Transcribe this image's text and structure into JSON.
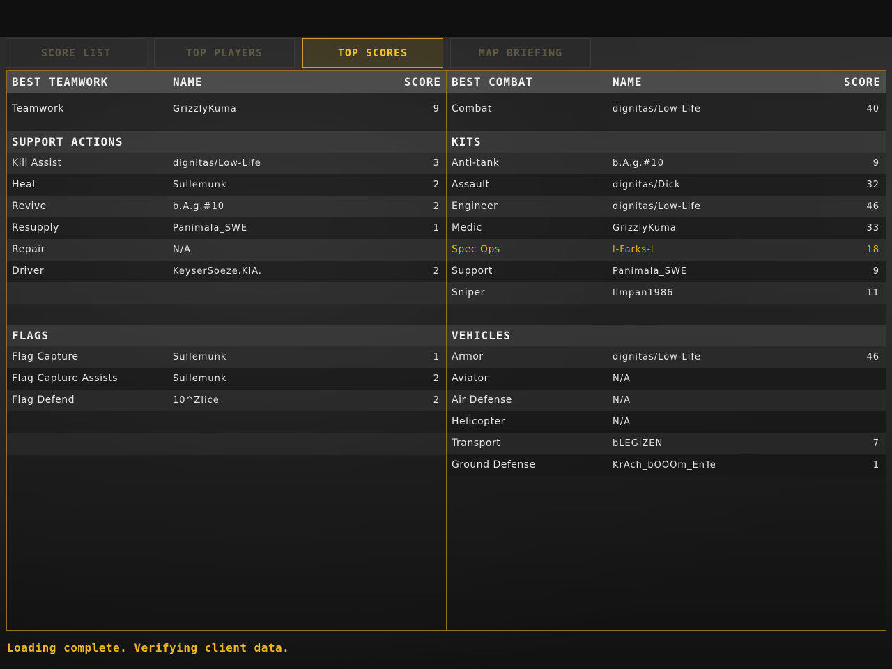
{
  "tabs": [
    {
      "label": "SCORE LIST",
      "active": false
    },
    {
      "label": "TOP PLAYERS",
      "active": false
    },
    {
      "label": "TOP SCORES",
      "active": true
    },
    {
      "label": "MAP BRIEFING",
      "active": false
    }
  ],
  "left": {
    "header": {
      "category": "BEST TEAMWORK",
      "name": "NAME",
      "score": "SCORE"
    },
    "teamwork": [
      {
        "category": "Teamwork",
        "name": "GrizzlyKuma",
        "score": "9"
      }
    ],
    "support_title": "SUPPORT ACTIONS",
    "support": [
      {
        "category": "Kill Assist",
        "name": "dignitas/Low-Life",
        "score": "3"
      },
      {
        "category": "Heal",
        "name": "Sullemunk",
        "score": "2"
      },
      {
        "category": "Revive",
        "name": "b.A.g.#10",
        "score": "2"
      },
      {
        "category": "Resupply",
        "name": "Panimala_SWE",
        "score": "1"
      },
      {
        "category": "Repair",
        "name": "N/A",
        "score": ""
      },
      {
        "category": "Driver",
        "name": "KeyserSoeze.KIA.",
        "score": "2"
      }
    ],
    "flags_title": "FLAGS",
    "flags": [
      {
        "category": "Flag Capture",
        "name": "Sullemunk",
        "score": "1"
      },
      {
        "category": "Flag Capture Assists",
        "name": "Sullemunk",
        "score": "2"
      },
      {
        "category": "Flag Defend",
        "name": "10^Zlice",
        "score": "2"
      }
    ]
  },
  "right": {
    "header": {
      "category": "BEST COMBAT",
      "name": "NAME",
      "score": "SCORE"
    },
    "combat": [
      {
        "category": "Combat",
        "name": "dignitas/Low-Life",
        "score": "40"
      }
    ],
    "kits_title": "KITS",
    "kits": [
      {
        "category": "Anti-tank",
        "name": "b.A.g.#10",
        "score": "9"
      },
      {
        "category": "Assault",
        "name": "dignitas/Dick",
        "score": "32"
      },
      {
        "category": "Engineer",
        "name": "dignitas/Low-Life",
        "score": "46"
      },
      {
        "category": "Medic",
        "name": "GrizzlyKuma",
        "score": "33"
      },
      {
        "category": "Spec Ops",
        "name": "l-Farks-l",
        "score": "18",
        "highlight": true
      },
      {
        "category": "Support",
        "name": "Panimala_SWE",
        "score": "9"
      },
      {
        "category": "Sniper",
        "name": "limpan1986",
        "score": "11"
      }
    ],
    "vehicles_title": "VEHICLES",
    "vehicles": [
      {
        "category": "Armor",
        "name": "dignitas/Low-Life",
        "score": "46"
      },
      {
        "category": "Aviator",
        "name": "N/A",
        "score": ""
      },
      {
        "category": "Air Defense",
        "name": "N/A",
        "score": ""
      },
      {
        "category": "Helicopter",
        "name": "N/A",
        "score": ""
      },
      {
        "category": "Transport",
        "name": "bLEGiZEN",
        "score": "7"
      },
      {
        "category": "Ground Defense",
        "name": "KrAch_bOOOm_EnTe",
        "score": "1"
      }
    ]
  },
  "status": "Loading complete.  Verifying client data.",
  "colors": {
    "accent": "#f2c230",
    "border": "#8a7420",
    "highlight": "#e2b322"
  }
}
